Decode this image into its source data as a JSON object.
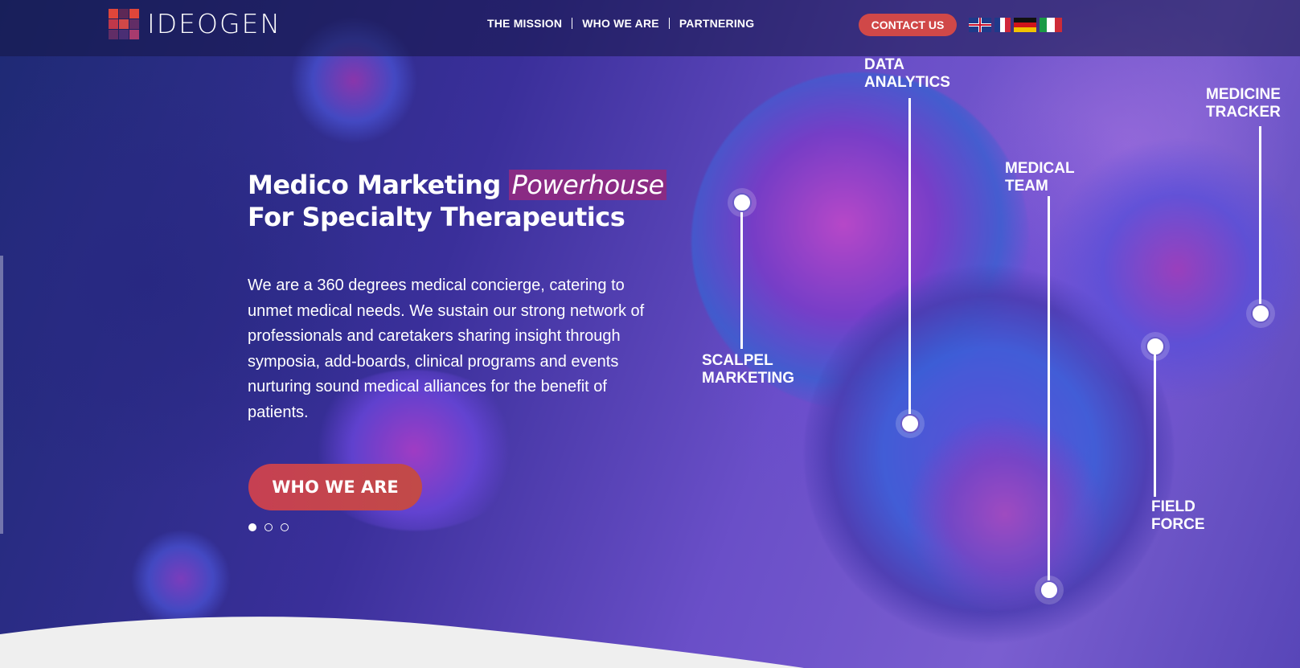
{
  "header": {
    "logo_text": "IDEOGEN",
    "logo_colors": [
      "#e0463a",
      "#c0384a",
      "#a83b6e",
      "#7a3e8a"
    ],
    "nav": [
      "THE MISSION",
      "WHO WE ARE",
      "PARTNERING"
    ],
    "contact_label": "CONTACT US",
    "languages": [
      "uk-flag-icon",
      "fr-flag-icon",
      "de-flag-icon",
      "it-flag-icon"
    ]
  },
  "hero": {
    "title_line1_a": "Medico Marketing ",
    "title_line1_highlight": "Powerhouse",
    "title_line2": "For Specialty Therapeutics",
    "description": "We are a 360 degrees medical concierge, catering to unmet medical needs. We sustain our strong network of professionals and caretakers sharing insight through symposia, add-boards, clinical programs and events nurturing sound medical alliances for the benefit of patients.",
    "cta_label": "WHO WE ARE",
    "slides": {
      "count": 3,
      "active": 1
    }
  },
  "callouts": [
    {
      "id": "scalpel",
      "label_line1": "SCALPEL",
      "label_line2": "MARKETING"
    },
    {
      "id": "data",
      "label_line1": "DATA",
      "label_line2": "ANALYTICS"
    },
    {
      "id": "medical",
      "label_line1": "MEDICAL",
      "label_line2": "TEAM"
    },
    {
      "id": "medicine",
      "label_line1": "MEDICINE",
      "label_line2": "TRACKER"
    },
    {
      "id": "field",
      "label_line1": "FIELD",
      "label_line2": "FORCE"
    }
  ],
  "colors": {
    "accent_red": "#d04848",
    "highlight_purple": "#8a2b84",
    "bg_blue": "#2a2a78"
  }
}
